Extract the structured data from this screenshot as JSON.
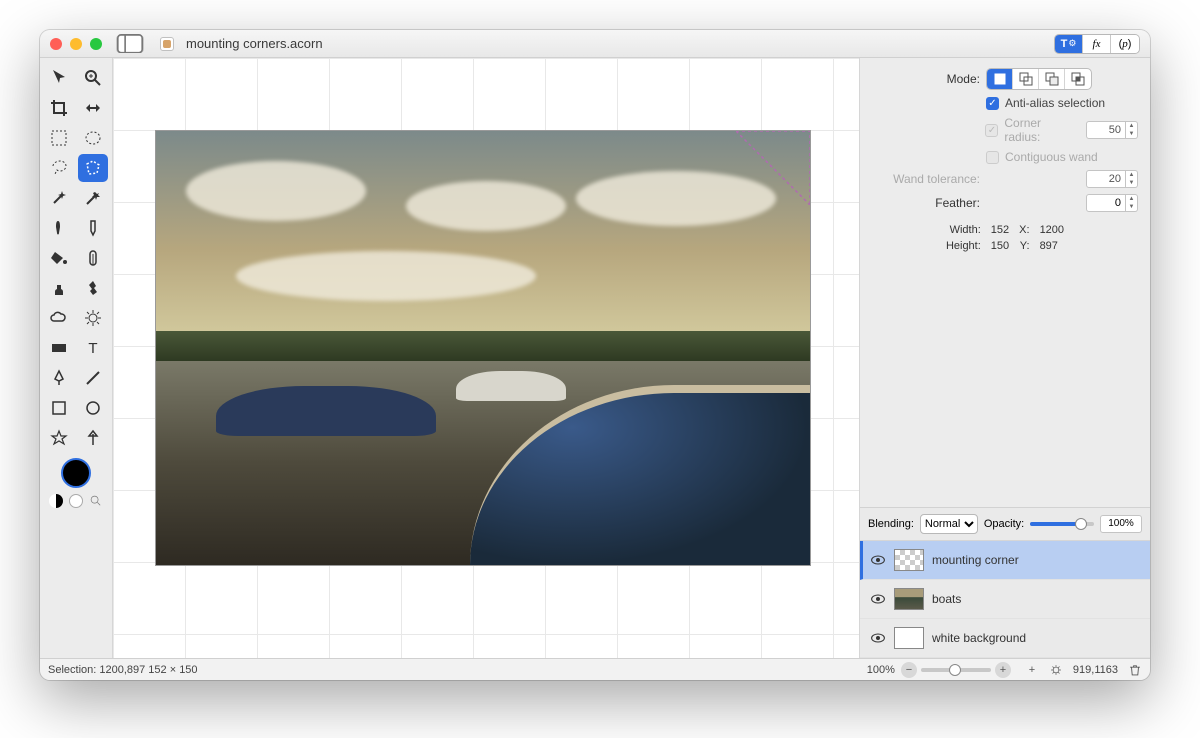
{
  "window": {
    "filename": "mounting corners.acorn"
  },
  "header_tabs": {
    "tools_label": "T",
    "fx_label": "fx",
    "p_label": "p"
  },
  "panel": {
    "mode_label": "Mode:",
    "antialias_label": "Anti-alias selection",
    "antialias_checked": true,
    "corner_radius_label": "Corner radius:",
    "corner_radius_value": "50",
    "contiguous_label": "Contiguous wand",
    "wand_tol_label": "Wand tolerance:",
    "wand_tol_value": "20",
    "feather_label": "Feather:",
    "feather_value": "0",
    "dims": {
      "width_k": "Width:",
      "width_v": "152",
      "height_k": "Height:",
      "height_v": "150",
      "x_k": "X:",
      "x_v": "1200",
      "y_k": "Y:",
      "y_v": "897"
    }
  },
  "blending": {
    "label": "Blending:",
    "mode": "Normal",
    "opacity_label": "Opacity:",
    "opacity_value": "100%"
  },
  "layers": [
    {
      "name": "mounting corner",
      "selected": true,
      "thumb": "checker"
    },
    {
      "name": "boats",
      "selected": false,
      "thumb": "boats"
    },
    {
      "name": "white background",
      "selected": false,
      "thumb": "white"
    }
  ],
  "status": {
    "selection_text": "Selection: 1200,897 152 × 150",
    "zoom_text": "100%",
    "coords": "919,1163"
  },
  "tools": {
    "row1": [
      "move-tool",
      "zoom-tool"
    ],
    "row2": [
      "crop-tool",
      "transform-tool"
    ],
    "row3": [
      "rect-select-tool",
      "ellipse-select-tool"
    ],
    "row4": [
      "lasso-tool",
      "polygon-select-tool"
    ],
    "row5": [
      "wand-tool",
      "quickmask-tool"
    ],
    "row6": [
      "brush-tool",
      "pencil-tool"
    ],
    "row7": [
      "fill-tool",
      "gradient-tool"
    ],
    "row8": [
      "clone-tool",
      "smudge-tool"
    ],
    "row9": [
      "cloud-shape-tool",
      "dodge-tool"
    ],
    "row10": [
      "rect-shape-tool",
      "text-tool"
    ],
    "row11": [
      "pen-tool",
      "line-tool"
    ],
    "row12": [
      "square-shape-tool",
      "circle-shape-tool"
    ],
    "row13": [
      "star-shape-tool",
      "arrow-shape-tool"
    ]
  }
}
